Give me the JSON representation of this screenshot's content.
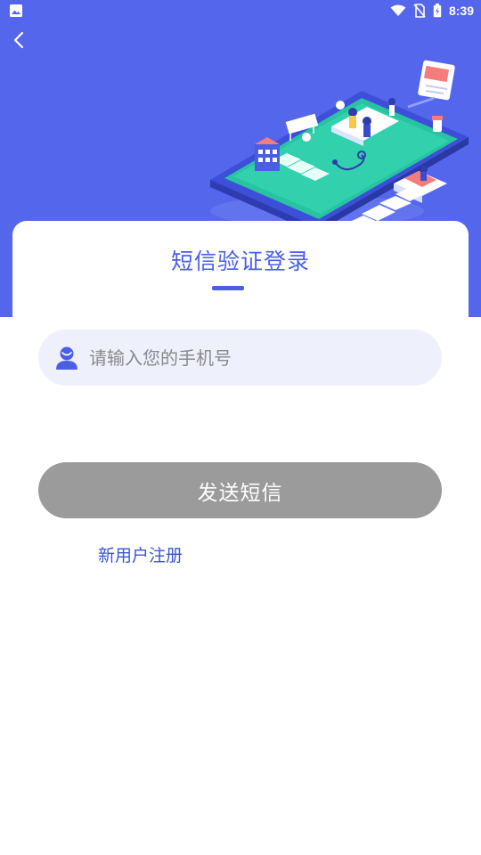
{
  "status_bar": {
    "time": "8:39",
    "left_icon": "gallery-notification-icon",
    "right_icons": [
      "wifi-icon",
      "no-sim-icon",
      "battery-charging-icon"
    ]
  },
  "nav": {
    "back_icon": "chevron-left-icon"
  },
  "hero": {
    "illustration": "phone-hospital-isometric-illustration",
    "background_color": "#5466ec"
  },
  "login": {
    "title": "短信验证登录",
    "phone_placeholder": "请输入您的手机号",
    "phone_value": "",
    "send_button_label": "发送短信",
    "register_link": "新用户注册"
  },
  "colors": {
    "accent": "#4a5ee8",
    "button_disabled": "#9b9b9b",
    "input_bg": "#eef0fc"
  }
}
